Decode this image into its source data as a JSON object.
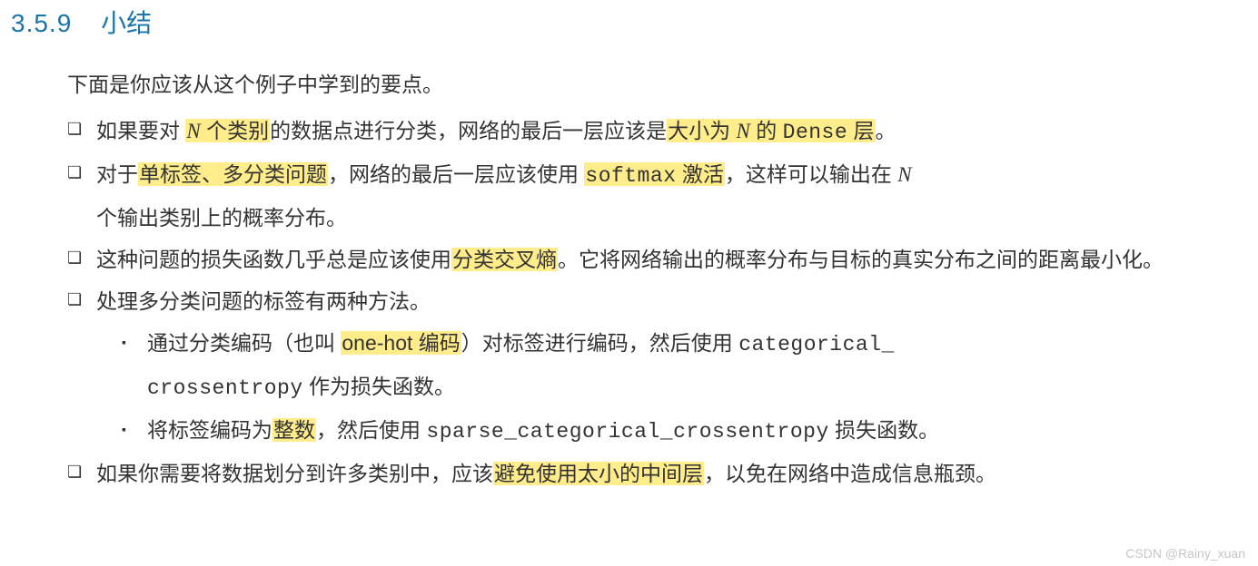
{
  "heading": {
    "number": "3.5.9",
    "title": "小结"
  },
  "intro": "下面是你应该从这个例子中学到的要点。",
  "bullet1": {
    "t1": "如果要对 ",
    "h1": "N",
    "h2": " 个类别",
    "t2": "的数据点进行分类，网络的最后一层应该是",
    "h3": "大小为 ",
    "h3_ital": "N",
    "h3b": " 的 ",
    "h3_code": "Dense",
    "h3c": " 层",
    "t3": "。"
  },
  "bullet2": {
    "t1": "对于",
    "h1": "单标签、多分类问题",
    "t2": "，网络的最后一层应该使用 ",
    "h2": "softmax",
    "h2b": " 激活",
    "t3": "，这样可以输出在 ",
    "ital": "N",
    "t4": "个输出类别上的概率分布。"
  },
  "bullet3": {
    "t1": "这种问题的损失函数几乎总是应该使用",
    "h1": "分类交叉熵",
    "t2": "。它将网络输出的概率分布与目标的真实分布之间的距离最小化。"
  },
  "bullet4": {
    "t1": "处理多分类问题的标签有两种方法。",
    "sub1": {
      "t1": "通过分类编码（也叫 ",
      "h1": "one-hot 编码",
      "t2": "）对标签进行编码，然后使用 ",
      "code1": "categorical_",
      "code2": "crossentropy",
      "t3": " 作为损失函数。"
    },
    "sub2": {
      "t1": "将标签编码为",
      "h1": "整数",
      "t2": "，然后使用 ",
      "code": "sparse_categorical_crossentropy",
      "t3": " 损失函数。"
    }
  },
  "bullet5": {
    "t1": "如果你需要将数据划分到许多类别中，应该",
    "h1": "避免使用太小的中间层",
    "t2": "，以免在网络中造成信息瓶颈。"
  },
  "watermark": "CSDN @Rainy_xuan"
}
